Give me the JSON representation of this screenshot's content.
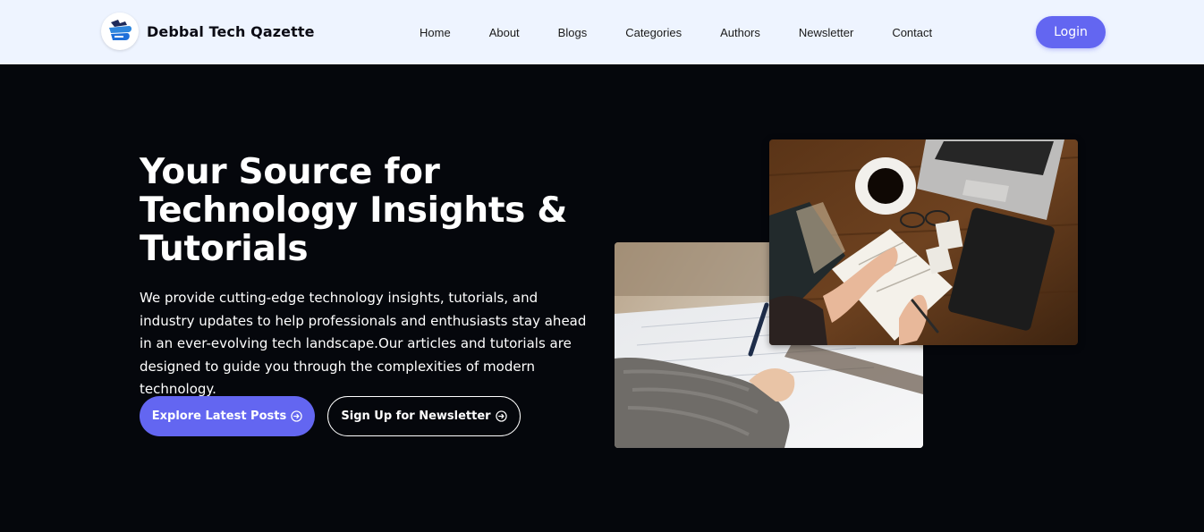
{
  "header": {
    "brand_name": "Debbal Tech Qazette",
    "logo_icon": "logo-icon",
    "nav": [
      "Home",
      "About",
      "Blogs",
      "Categories",
      "Authors",
      "Newsletter",
      "Contact"
    ],
    "login_label": "Login"
  },
  "hero": {
    "title_line1": "Your Source for",
    "title_line2": "Technology Insights &",
    "title_line3": "Tutorials",
    "description": "We provide cutting-edge technology insights, tutorials, and industry updates to help professionals and enthusiasts stay ahead in an ever-evolving tech landscape.Our articles and tutorials are designed to guide you through the complexities of modern technology.",
    "primary_cta": "Explore Latest Posts",
    "secondary_cta": "Sign Up for Newsletter",
    "cta_icon": "arrow-right-circle-icon"
  },
  "images": {
    "back_photo": "hand-writing-notes-photo",
    "front_photo": "desk-with-laptop-coffee-photo"
  },
  "colors": {
    "accent": "#6366f1",
    "header_bg": "#eef4ff",
    "hero_bg": "#05070c"
  }
}
